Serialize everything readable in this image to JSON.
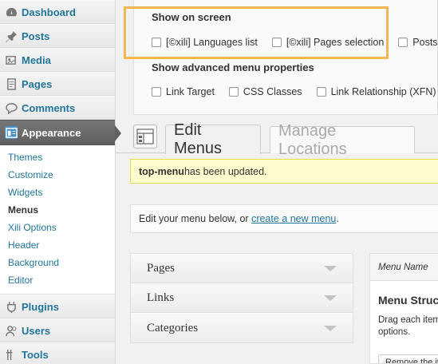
{
  "sidebar": {
    "top_items": [
      {
        "label": "Dashboard",
        "icon": "dashboard-icon"
      },
      {
        "label": "Posts",
        "icon": "pin-icon"
      },
      {
        "label": "Media",
        "icon": "media-icon"
      },
      {
        "label": "Pages",
        "icon": "pages-icon"
      },
      {
        "label": "Comments",
        "icon": "comment-icon"
      }
    ],
    "appearance": {
      "label": "Appearance",
      "icon": "appearance-icon"
    },
    "submenu": [
      "Themes",
      "Customize",
      "Widgets",
      "Menus",
      "Xili Options",
      "Header",
      "Background",
      "Editor"
    ],
    "active_submenu": "Menus",
    "bottom_items": [
      {
        "label": "Plugins",
        "icon": "plugin-icon"
      },
      {
        "label": "Users",
        "icon": "users-icon"
      },
      {
        "label": "Tools",
        "icon": "tools-icon"
      }
    ]
  },
  "screen_options": {
    "show_heading": "Show on screen",
    "show_items": [
      "[©xili] Languages list",
      "[©xili] Pages selection",
      "Posts"
    ],
    "advanced_heading": "Show advanced menu properties",
    "advanced_items": [
      "Link Target",
      "CSS Classes",
      "Link Relationship (XFN)"
    ]
  },
  "tabs": {
    "edit": "Edit Menus",
    "manage": "Manage Locations"
  },
  "notice": {
    "menu_name": "top-menu",
    "message": " has been updated."
  },
  "edit_box": {
    "prefix": "Edit your menu below, or ",
    "link": "create a new menu",
    "suffix": "."
  },
  "accordion": [
    "Pages",
    "Links",
    "Categories"
  ],
  "menu_panel": {
    "header": "Menu Name",
    "title": "Menu Structure",
    "desc_line1": "Drag each item",
    "desc_line2": "options.",
    "button": "Remove the item"
  },
  "colors": {
    "link": "#21759b",
    "highlight": "#f4b650",
    "notice_bg": "#fffbcc"
  }
}
